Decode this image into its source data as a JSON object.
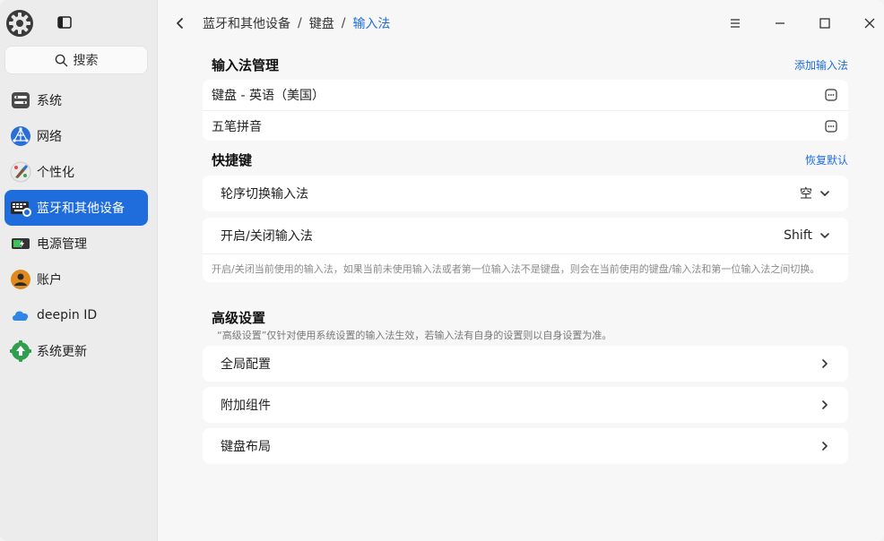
{
  "sidebar": {
    "search_placeholder": "搜索",
    "items": [
      {
        "label": "系统",
        "icon": "system-icon"
      },
      {
        "label": "网络",
        "icon": "network-icon"
      },
      {
        "label": "个性化",
        "icon": "personalization-icon"
      },
      {
        "label": "蓝牙和其他设备",
        "icon": "bluetooth-devices-icon",
        "active": true
      },
      {
        "label": "电源管理",
        "icon": "power-icon"
      },
      {
        "label": "账户",
        "icon": "account-icon"
      },
      {
        "label": "deepin ID",
        "icon": "cloud-icon"
      },
      {
        "label": "系统更新",
        "icon": "update-icon"
      }
    ]
  },
  "breadcrumb": {
    "items": [
      "蓝牙和其他设备",
      "键盘",
      "输入法"
    ],
    "separator": "/"
  },
  "input_methods": {
    "title": "输入法管理",
    "action": "添加输入法",
    "list": [
      "键盘 - 英语（美国）",
      "五笔拼音"
    ]
  },
  "shortcuts": {
    "title": "快捷键",
    "action": "恢复默认",
    "switch_label": "轮序切换输入法",
    "switch_value": "空",
    "toggle_label": "开启/关闭输入法",
    "toggle_value": "Shift",
    "toggle_note": "开启/关闭当前使用的输入法，如果当前未使用输入法或者第一位输入法不是键盘，则会在当前使用的键盘/输入法和第一位输入法之间切换。"
  },
  "advanced": {
    "title": "高级设置",
    "description": "“高级设置”仅针对使用系统设置的输入法生效，若输入法有自身的设置则以自身设置为准。",
    "items": [
      "全局配置",
      "附加组件",
      "键盘布局"
    ]
  },
  "colors": {
    "accent": "#1f6ddd",
    "background": "#f7f7f7",
    "card": "#ffffff"
  }
}
